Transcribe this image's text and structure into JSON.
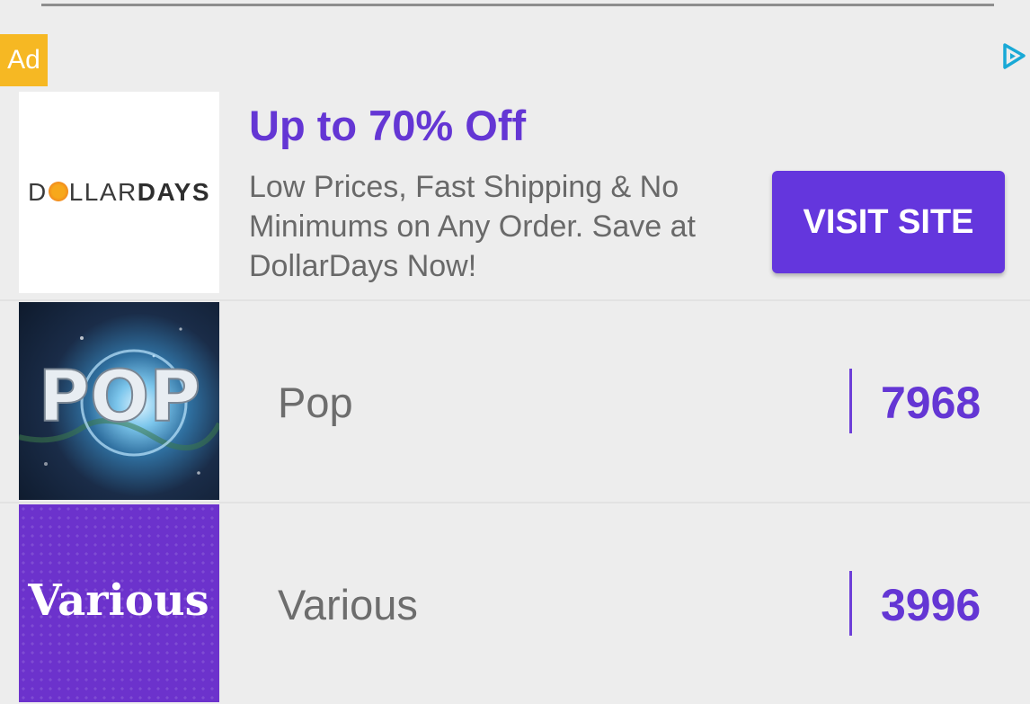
{
  "ad": {
    "badge": "Ad",
    "logo": {
      "prefix": "D",
      "middle": "LLAR",
      "bold": "DAYS"
    },
    "headline": "Up to 70% Off",
    "description": "Low Prices, Fast Shipping & No Minimums on Any Order. Save at DollarDays Now!",
    "cta_label": "VISIT SITE",
    "adchoices_icon": "adchoices-icon"
  },
  "genres": [
    {
      "name": "Pop",
      "count": "7968",
      "thumbnail_text": "POP",
      "thumbnail_icon": "pop-album-art"
    },
    {
      "name": "Various",
      "count": "3996",
      "thumbnail_text": "Various",
      "thumbnail_icon": "various-album-art"
    }
  ],
  "colors": {
    "accent": "#6436d4",
    "ad_badge": "#f6b823",
    "background": "#ededed",
    "muted_text": "#6d6d6d"
  }
}
